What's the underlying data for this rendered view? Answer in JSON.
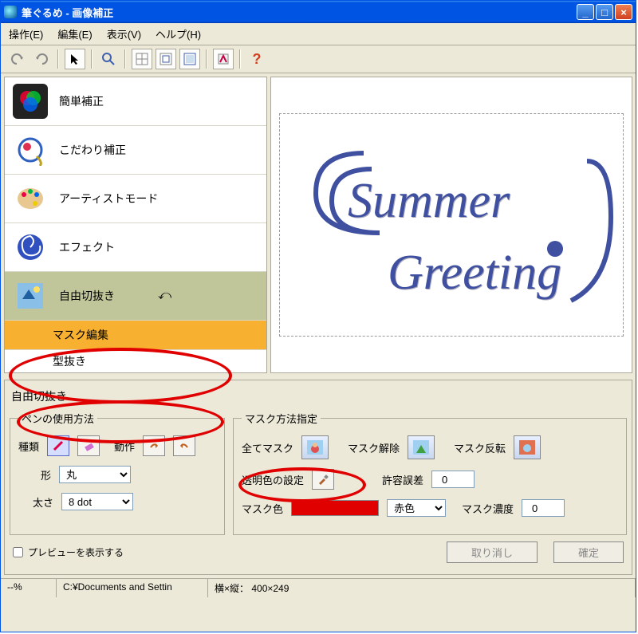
{
  "window": {
    "title": "筆ぐるめ - 画像補正"
  },
  "menu": {
    "file": "操作(E)",
    "edit": "編集(E)",
    "view": "表示(V)",
    "help": "ヘルプ(H)"
  },
  "toolbar": {
    "help_char": "?"
  },
  "sidebar": {
    "items": [
      {
        "label": "簡単補正"
      },
      {
        "label": "こだわり補正"
      },
      {
        "label": "アーティストモード"
      },
      {
        "label": "エフェクト"
      },
      {
        "label": "自由切抜き"
      }
    ],
    "sub": {
      "label": "マスク編集"
    },
    "sub2": {
      "label": "型抜き"
    }
  },
  "canvas": {
    "line1": "Summer",
    "line2": "Greeting"
  },
  "panel": {
    "title": "自由切抜き",
    "pen_group": "ペンの使用方法",
    "mask_group": "マスク方法指定",
    "type_label": "種類",
    "action_label": "動作",
    "shape_label": "形",
    "shape_value": "丸",
    "thickness_label": "太さ",
    "thickness_value": "8 dot",
    "mask_all": "全てマスク",
    "mask_release": "マスク解除",
    "mask_invert": "マスク反転",
    "transp_label": "透明色の設定",
    "tolerance_label": "許容誤差",
    "tolerance_value": "0",
    "mask_color_label": "マスク色",
    "mask_color_value": "赤色",
    "mask_color_hex": "#e00000",
    "mask_density_label": "マスク濃度",
    "mask_density_value": "0",
    "preview_label": "プレビューを表示する",
    "btn_reset": "取り消し",
    "btn_apply": "確定"
  },
  "statusbar": {
    "left": "--%",
    "path": "C:¥Documents and Settin",
    "dims": "横×縦： 400×249"
  }
}
